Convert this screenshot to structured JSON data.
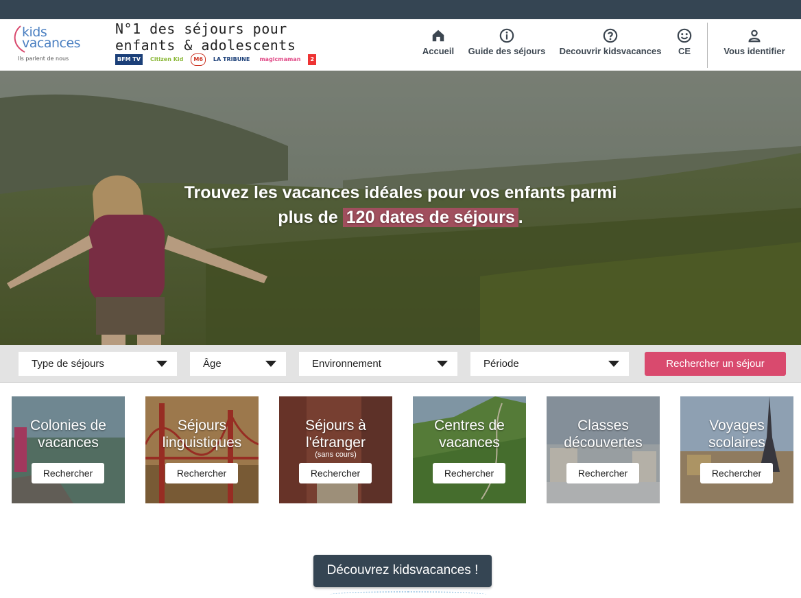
{
  "header": {
    "logo_text_1": "kids",
    "logo_text_2": "vacances",
    "logo_tagline": "Ils parlent de nous",
    "slogan": "N°1 des séjours pour enfants & adolescents",
    "press_logos": [
      "BFM TV",
      "Citizen Kid",
      "M6",
      "LA TRIBUNE",
      "magicmaman",
      "2"
    ]
  },
  "nav": {
    "items": [
      {
        "label": "Accueil",
        "icon": "home-icon"
      },
      {
        "label": "Guide des séjours",
        "icon": "info-icon"
      },
      {
        "label": "Decouvrir kidsvacances",
        "icon": "help-icon"
      },
      {
        "label": "CE",
        "icon": "smiley-icon"
      },
      {
        "label": "Vous identifier",
        "icon": "user-icon"
      }
    ]
  },
  "hero": {
    "line1": "Trouvez les vacances idéales pour vos enfants parmi",
    "line2_prefix": "plus de",
    "highlight": "120 dates de séjours",
    "line2_suffix": "."
  },
  "search": {
    "type_label": "Type de séjours",
    "age_label": "Âge",
    "env_label": "Environnement",
    "period_label": "Période",
    "button_label": "Rechercher un séjour"
  },
  "categories": [
    {
      "title": "Colonies de vacances",
      "subtitle": "",
      "button": "Rechercher"
    },
    {
      "title": "Séjours linguistiques",
      "subtitle": "",
      "button": "Rechercher"
    },
    {
      "title": "Séjours à l'étranger",
      "subtitle": "(sans cours)",
      "button": "Rechercher"
    },
    {
      "title": "Centres de vacances",
      "subtitle": "",
      "button": "Rechercher"
    },
    {
      "title": "Classes découvertes",
      "subtitle": "",
      "button": "Rechercher"
    },
    {
      "title": "Voyages scolaires",
      "subtitle": "",
      "button": "Rechercher"
    }
  ],
  "discover_button": "Découvrez kidsvacances !",
  "colors": {
    "topbar": "#354553",
    "accent": "#d94a6e",
    "highlight": "#b94b69",
    "nav_text": "#3c4650"
  }
}
